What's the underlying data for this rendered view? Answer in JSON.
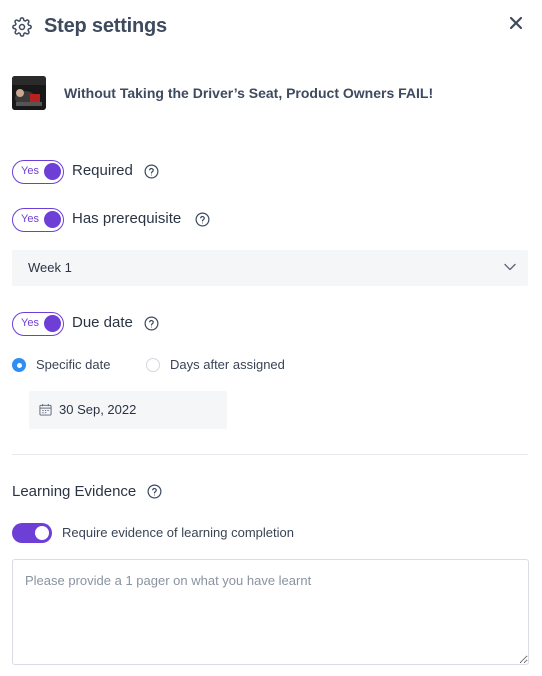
{
  "header": {
    "title": "Step settings",
    "gear_icon": "gear-icon",
    "close_icon": "close-icon"
  },
  "course": {
    "title": "Without Taking the Driver’s Seat, Product Owners FAIL!",
    "thumbnail": "course-thumbnail"
  },
  "required": {
    "toggle_text": "Yes",
    "label": "Required",
    "on": true
  },
  "prerequisite": {
    "toggle_text": "Yes",
    "label": "Has prerequisite",
    "on": true,
    "select_value": "Week 1"
  },
  "due_date": {
    "toggle_text": "Yes",
    "label": "Due date",
    "on": true,
    "options": [
      {
        "label": "Specific date",
        "selected": true
      },
      {
        "label": "Days after assigned",
        "selected": false
      }
    ],
    "date_value": "30 Sep, 2022"
  },
  "learning_evidence": {
    "title": "Learning Evidence",
    "switch_label": "Require evidence of learning completion",
    "switch_on": true,
    "textarea_placeholder": "Please provide a 1 pager on what you have learnt",
    "textarea_value": ""
  },
  "colors": {
    "accent": "#6d3fd6",
    "radio": "#2f8ef4",
    "field_bg": "#f4f6f8",
    "text": "#2b3445"
  }
}
